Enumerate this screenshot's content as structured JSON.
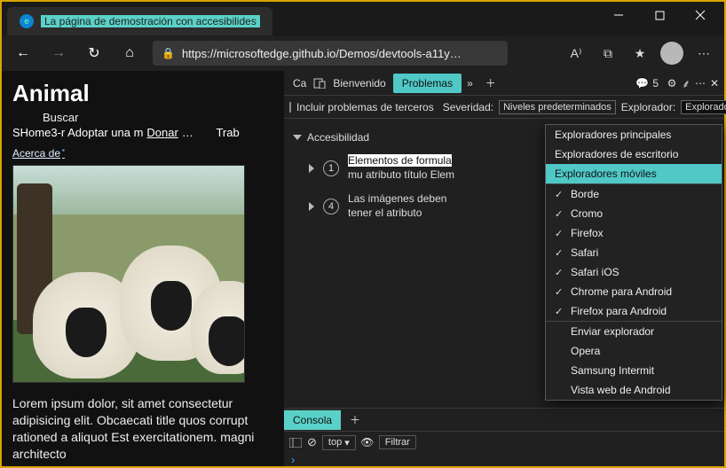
{
  "titlebar": {
    "tab_title": "La página de demostración con accesibilid",
    "tab_title_fade": "es"
  },
  "addr": {
    "url": "https://microsoftedge.github.io/Demos/devtools-a11y…"
  },
  "page": {
    "h1": "Animal",
    "nav_buscar": "Buscar",
    "nav_line": "SHome3-r Adoptar una m",
    "nav_donar": "Donar",
    "nav_ellip": "…",
    "nav_trab": "Trab",
    "acerca": "Acerca de",
    "lorem": "Lorem ipsum dolor, sit amet consectetur adipisicing elit. Obcaecati title quos corrupt rationed a aliquot Est exercitationem. magni architecto"
  },
  "devtools": {
    "inspect_label": "Ca",
    "tab_bienvenido": "Bienvenido",
    "tab_problemas": "Problemas",
    "issue_badge": "5",
    "filter": {
      "include": "Incluir problemas de terceros",
      "sev_label": "Severidad:",
      "sev_value": "Niveles predeterminados",
      "expl_label": "Explorador:",
      "expl_value": "Exploradores principales"
    },
    "acc_header": "Accesibilidad",
    "issues": [
      {
        "count": "1",
        "text_hl": "Elementos de formula",
        "text2": "mu atributo título Elem"
      },
      {
        "count": "4",
        "text": "Las imágenes deben tener el atributo"
      }
    ],
    "drawer": {
      "console": "Consola",
      "top": "top",
      "filtrar": "Filtrar"
    }
  },
  "dropdown": {
    "group1": [
      {
        "label": "Exploradores principales",
        "sel": false
      },
      {
        "label": "Exploradores de escritorio",
        "sel": false
      },
      {
        "label": "Exploradores móviles",
        "sel": true
      }
    ],
    "group2": [
      {
        "label": "Borde",
        "ck": true
      },
      {
        "label": "Cromo",
        "ck": true
      },
      {
        "label": "Firefox",
        "ck": true
      },
      {
        "label": "Safari",
        "ck": true
      },
      {
        "label": "Safari iOS",
        "ck": true
      },
      {
        "label": "Chrome para Android",
        "ck": true
      },
      {
        "label": "Firefox para Android",
        "ck": true
      }
    ],
    "group3": [
      {
        "label": "Enviar explorador"
      },
      {
        "label": "Opera"
      },
      {
        "label": "Samsung Intermit"
      },
      {
        "label": "Vista web de Android"
      }
    ]
  }
}
